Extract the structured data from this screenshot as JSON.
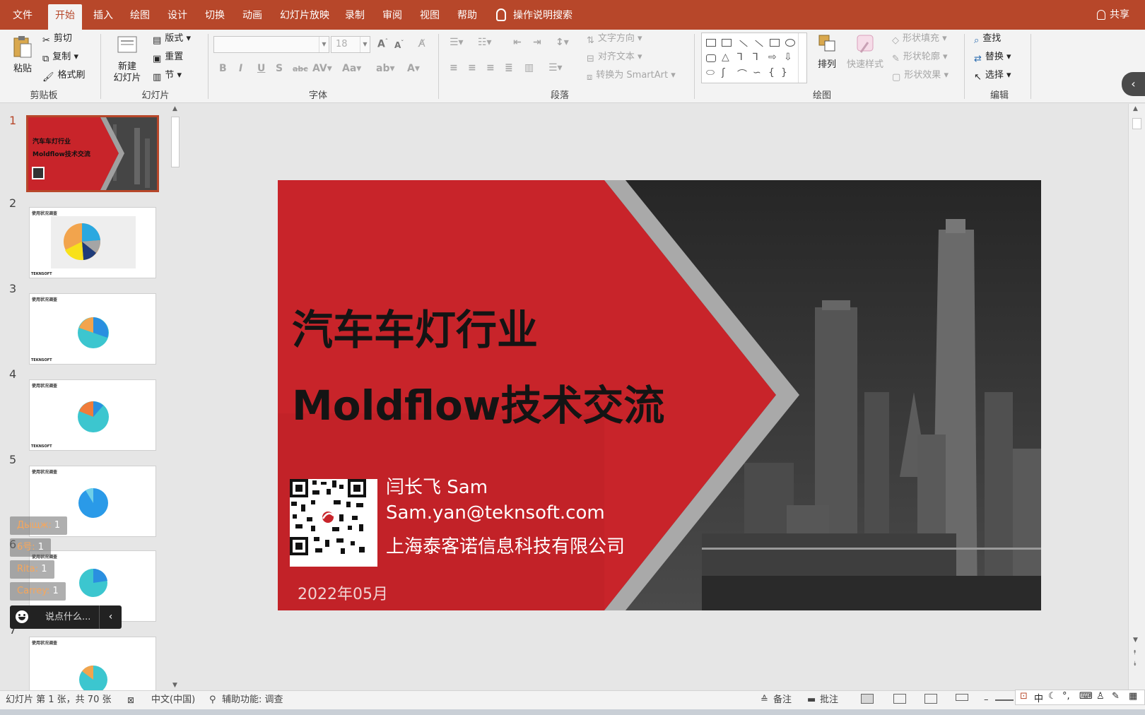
{
  "tabs": [
    "文件",
    "开始",
    "插入",
    "绘图",
    "设计",
    "切换",
    "动画",
    "幻灯片放映",
    "录制",
    "审阅",
    "视图",
    "帮助"
  ],
  "active_tab_index": 1,
  "tell_me": "操作说明搜索",
  "share": "共享",
  "clipboard": {
    "paste": "粘贴",
    "cut": "剪切",
    "copy": "复制",
    "painter": "格式刷",
    "label": "剪贴板"
  },
  "slides": {
    "new": "新建\n幻灯片",
    "layout": "版式",
    "reset": "重置",
    "section": "节",
    "label": "幻灯片"
  },
  "font": {
    "name_value": "",
    "size_value": "18",
    "label": "字体"
  },
  "paragraph": {
    "text_dir": "文字方向",
    "align_text": "对齐文本",
    "smartart": "转换为 SmartArt",
    "label": "段落"
  },
  "drawing": {
    "arrange": "排列",
    "quick_styles": "快速样式",
    "fill": "形状填充",
    "outline": "形状轮廓",
    "effects": "形状效果",
    "label": "绘图"
  },
  "editing": {
    "find": "查找",
    "replace": "替换",
    "select": "选择",
    "label": "编辑"
  },
  "thumbnails": {
    "numbers": [
      "1",
      "2",
      "3",
      "4",
      "5",
      "6",
      "7"
    ],
    "active": 1,
    "slide1_line1": "汽车车灯行业",
    "slide1_line2": "Moldflow技术交流",
    "slide_header": "使用状况调查",
    "brand": "TEKNSOFT"
  },
  "overlay": {
    "messages": [
      {
        "name": "Дыщж:",
        "count": "1"
      },
      {
        "name": "6号:",
        "count": "1"
      },
      {
        "name": "Rita:",
        "count": "1"
      },
      {
        "name": "Carrey:",
        "count": "1"
      }
    ],
    "input_placeholder": "说点什么..."
  },
  "slide": {
    "title_line1": "汽车车灯行业",
    "title_line2": "Moldflow技术交流",
    "name": "闫长飞 Sam",
    "email": "Sam.yan@teknsoft.com",
    "company": "上海泰客诺信息科技有限公司",
    "date": "2022年05月",
    "colors": {
      "red": "#c8242a",
      "gray": "#3d3d3d"
    }
  },
  "status": {
    "slide_count": "幻灯片 第 1 张，共 70 张",
    "language": "中文(中国)",
    "accessibility": "辅助功能: 调查",
    "notes": "备注",
    "comments": "批注"
  },
  "ime": {
    "mode": "中"
  },
  "colors": {
    "accent": "#b7472a"
  }
}
